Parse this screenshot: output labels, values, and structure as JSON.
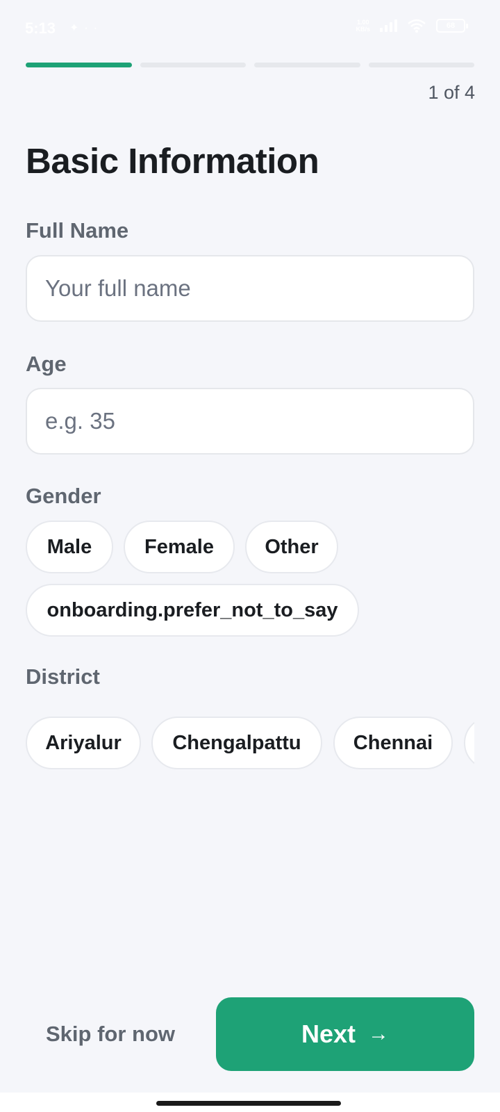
{
  "status_bar": {
    "time": "5:13",
    "left_icons": [
      "messenger-icon",
      "notification-dots-icon"
    ],
    "net_speed_value": "1.00",
    "net_speed_unit": "KB/s",
    "battery": "68"
  },
  "progress": {
    "current": 1,
    "total": 4,
    "label": "1 of 4",
    "accent_color": "#1ea276"
  },
  "title": "Basic Information",
  "full_name": {
    "label": "Full Name",
    "placeholder": "Your full name",
    "value": ""
  },
  "age": {
    "label": "Age",
    "placeholder": "e.g. 35",
    "value": ""
  },
  "gender": {
    "label": "Gender",
    "options": [
      "Male",
      "Female",
      "Other",
      "onboarding.prefer_not_to_say"
    ]
  },
  "district": {
    "label": "District",
    "options": [
      "Ariyalur",
      "Chengalpattu",
      "Chennai"
    ]
  },
  "footer": {
    "skip_label": "Skip for now",
    "next_label": "Next",
    "next_icon": "arrow-right-icon"
  }
}
